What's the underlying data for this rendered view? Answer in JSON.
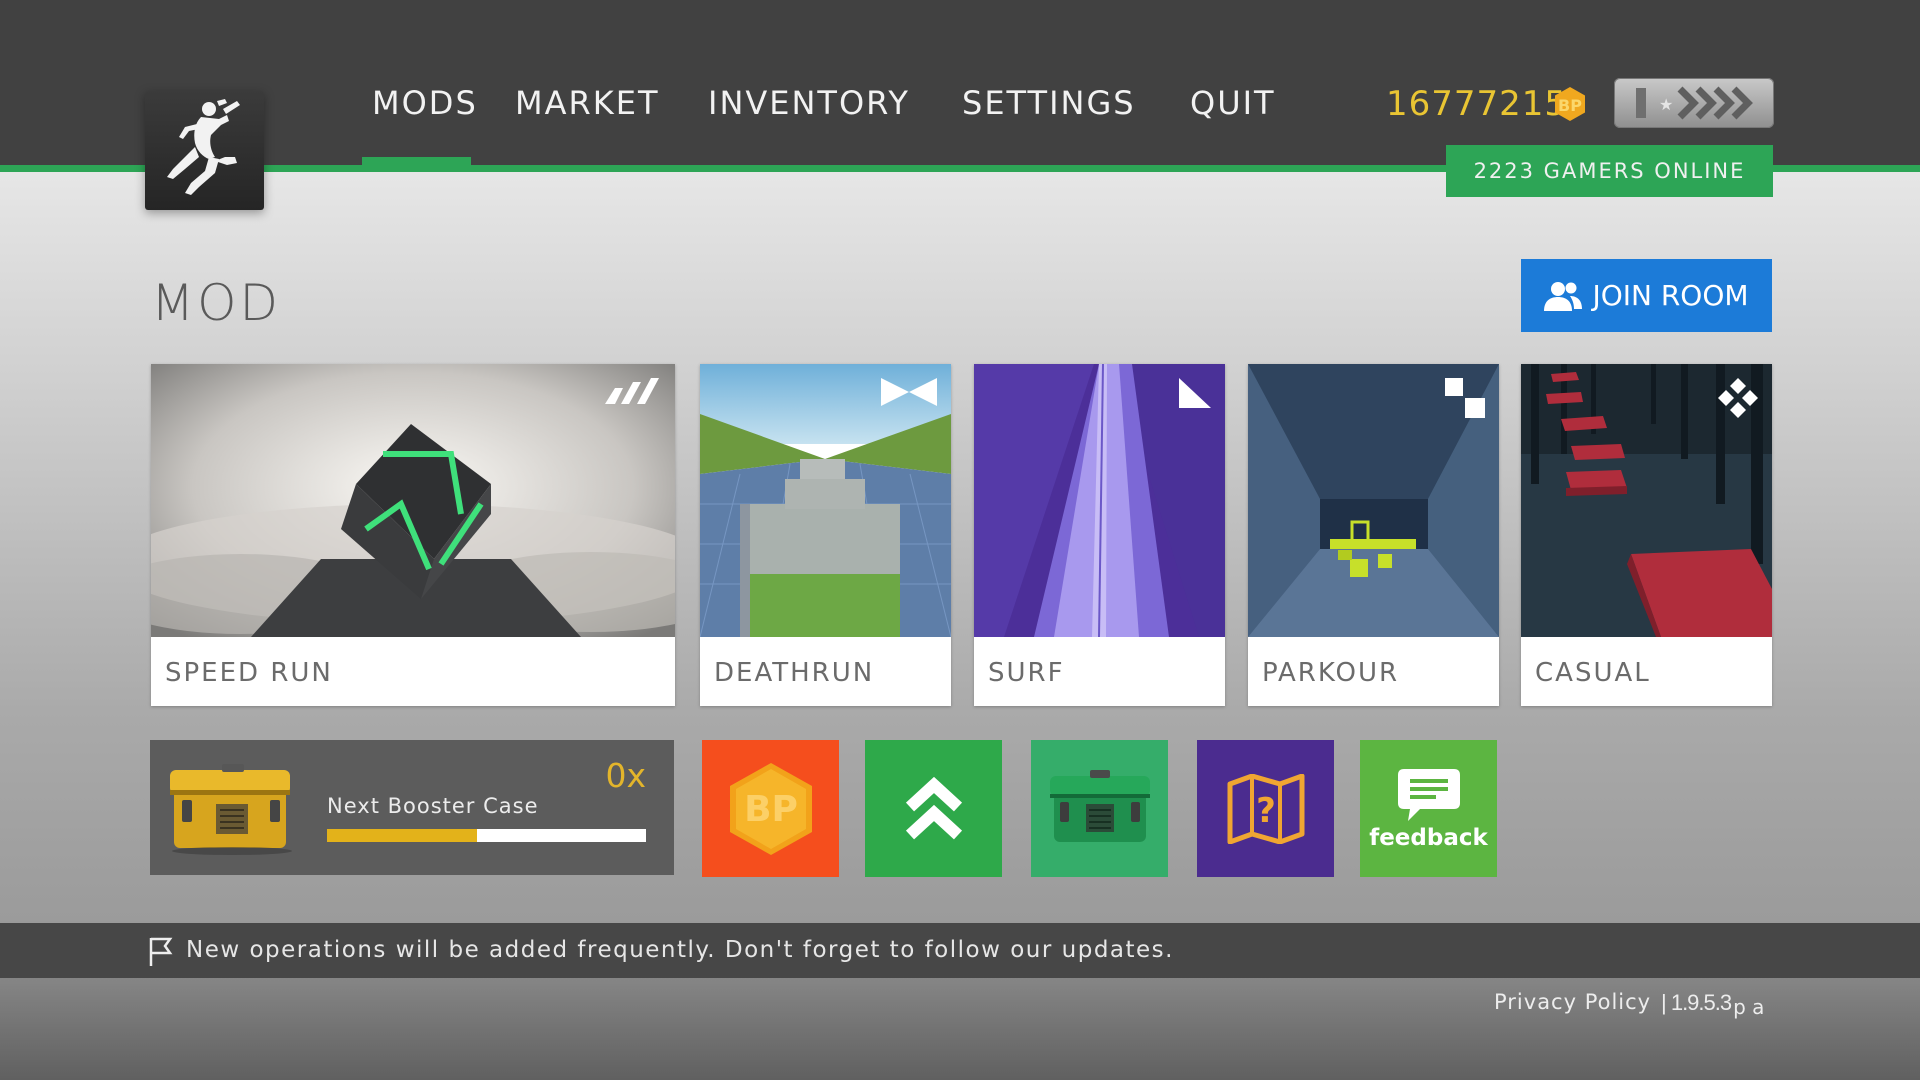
{
  "nav": {
    "items": [
      {
        "label": "MODS",
        "active": true
      },
      {
        "label": "MARKET"
      },
      {
        "label": "INVENTORY"
      },
      {
        "label": "SETTINGS"
      },
      {
        "label": "QUIT"
      }
    ]
  },
  "header": {
    "currency_amount": "16777215",
    "currency_icon": "bp-coin-icon",
    "rank_icon": "rank-chevrons-icon",
    "online_status": "2223 GAMERS ONLINE",
    "logo_icon": "jumping-soldier-icon"
  },
  "main": {
    "section_title": "MOD",
    "join_room_label": "JOIN ROOM",
    "join_room_icon": "users-icon",
    "mods": [
      {
        "name": "SPEED RUN",
        "badge_icon": "bars-icon"
      },
      {
        "name": "DEATHRUN",
        "badge_icon": "bowtie-icon"
      },
      {
        "name": "SURF",
        "badge_icon": "triangle-icon"
      },
      {
        "name": "PARKOUR",
        "badge_icon": "squares-icon"
      },
      {
        "name": "CASUAL",
        "badge_icon": "diamond-icon"
      }
    ]
  },
  "booster": {
    "label": "Next Booster Case",
    "count": "0x",
    "progress": 0.47,
    "icon": "booster-case-icon"
  },
  "tiles": [
    {
      "name": "bp-shop",
      "icon": "bp-icon",
      "color": "#f54e1d"
    },
    {
      "name": "rank-up",
      "icon": "double-chevron-up-icon",
      "color": "#2ea94a"
    },
    {
      "name": "cases",
      "icon": "green-case-icon",
      "color": "#35ad6a"
    },
    {
      "name": "missions",
      "icon": "map-question-icon",
      "color": "#4b2c8f"
    },
    {
      "name": "feedback",
      "icon": "feedback-icon",
      "label": "feedback",
      "color": "#5cb541"
    }
  ],
  "footer": {
    "message": "New operations will be added frequently. Don't forget to follow our updates.",
    "message_icon": "flag-icon",
    "privacy_label": "Privacy Policy",
    "version": "| 1.9.5.3",
    "version_suffix": "p a"
  },
  "colors": {
    "accent_green": "#2da556",
    "header_bg": "#414141",
    "currency_gold": "#e9c533",
    "join_blue": "#1c7bd8"
  }
}
